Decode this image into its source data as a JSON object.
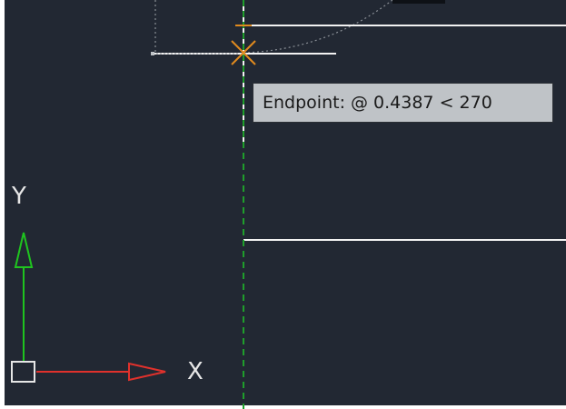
{
  "colors": {
    "background": "#222833",
    "model_lines": "#f2f2f2",
    "tracking_line": "#1f9e2b",
    "snap_marker": "#e08a1e",
    "ucs_x_axis": "#e0312c",
    "ucs_y_axis": "#1fc41f",
    "ucs_origin": "#e6e6e6",
    "tooltip_bg": "#bfc3c7",
    "tooltip_text": "#1a1a1a"
  },
  "tooltip": {
    "text": "Endpoint: @ 0.4387 < 270"
  },
  "ucs": {
    "x_label": "X",
    "y_label": "Y"
  },
  "icons": {
    "snap_marker": "endpoint-snap-icon",
    "ucs": "ucs-icon"
  }
}
